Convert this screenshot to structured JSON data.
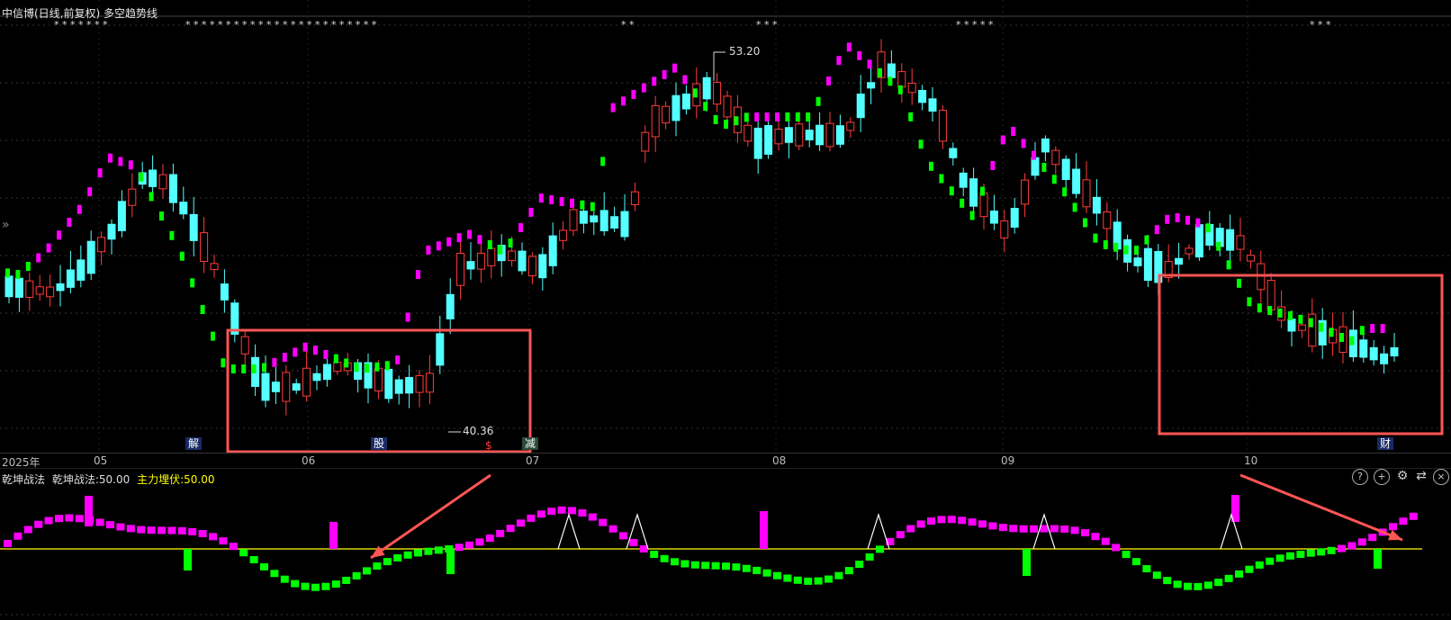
{
  "header": {
    "title": "中信博(日线,前复权) 多空趋势线"
  },
  "star_groups": [
    "****  *  **",
    "*  **  **  *  *  ***  *****  *****  ****",
    "**",
    "***",
    "***  *  *",
    "*  *  *"
  ],
  "chart": {
    "high_label": "53.20",
    "low_label": "40.36",
    "expand_icon": "»"
  },
  "markers": {
    "m1": "解",
    "m2": "股",
    "m3": "$",
    "m4": "减",
    "m5": "财"
  },
  "xaxis": {
    "year": "2025年",
    "months": [
      "05",
      "06",
      "07",
      "08",
      "09",
      "10"
    ]
  },
  "sub": {
    "name": "乾坤战法",
    "line1": "乾坤战法:50.00",
    "line2": "主力埋伏:50.00"
  },
  "toolbar_icons": [
    "question-icon",
    "zoom-in-icon",
    "settings-icon",
    "swap-icon",
    "close-icon"
  ],
  "colors": {
    "up": "#ff3b3b",
    "down": "#54ffff",
    "trend_up": "#ff00ff",
    "trend_down": "#00ff00",
    "annotation": "#ff5555",
    "baseline": "#ffff00"
  }
}
